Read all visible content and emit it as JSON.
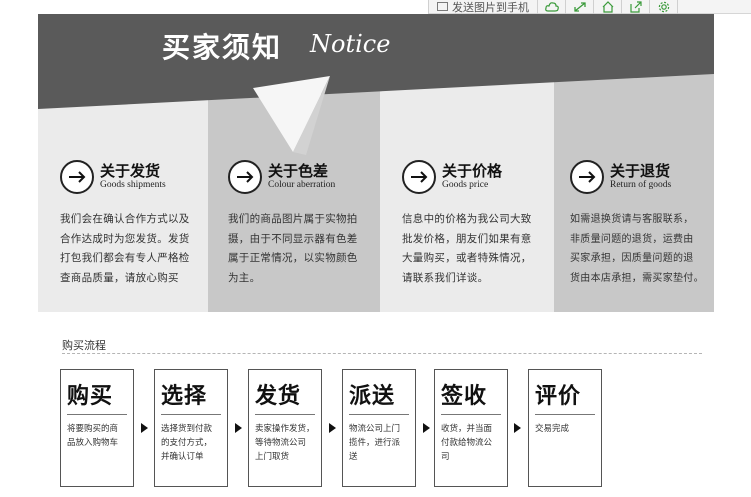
{
  "toolbar": {
    "send_label": "发送图片到手机"
  },
  "banner": {
    "title_zh": "买家须知",
    "title_en": "Notice"
  },
  "sections": [
    {
      "title": "关于发货",
      "subtitle": "Goods shipments",
      "lines": [
        "我们会在确认合作方式以及",
        "合作达成时为您发货。发货",
        "打包我们都会有专人严格检",
        "查商品质量，请放心购买"
      ]
    },
    {
      "title": "关于色差",
      "subtitle": "Colour aberration",
      "lines": [
        "我们的商品图片属于实物拍",
        "摄，由于不同显示器有色差",
        "属于正常情况，以实物颜色",
        "为主。"
      ]
    },
    {
      "title": "关于价格",
      "subtitle": "Goods price",
      "lines": [
        "信息中的价格为我公司大致",
        "批发价格，朋友们如果有意",
        "大量购买，或者特殊情况，",
        "请联系我们详谈。"
      ]
    },
    {
      "title": "关于退货",
      "subtitle": "Return of goods",
      "lines": [
        "如需退换货请与客服联系，",
        "非质量问题的退货，运费由",
        "买家承担，因质量问题的退",
        "货由本店承担，需买家垫付。"
      ]
    }
  ],
  "process": {
    "title": "购买流程",
    "steps": [
      {
        "title": "购买",
        "lines": [
          "将要购买的商",
          "品放入购物车"
        ]
      },
      {
        "title": "选择",
        "lines": [
          "选择货到付款",
          "的支付方式，",
          "并确认订单"
        ]
      },
      {
        "title": "发货",
        "lines": [
          "卖家操作发货，",
          "等待物流公司",
          "上门取货"
        ]
      },
      {
        "title": "派送",
        "lines": [
          "物流公司上门",
          "揽件，进行派",
          "送"
        ]
      },
      {
        "title": "签收",
        "lines": [
          "收货，并当面",
          "付款给物流公",
          "司"
        ]
      },
      {
        "title": "评价",
        "lines": [
          "交易完成"
        ]
      }
    ]
  },
  "colors": {
    "banner_dark": "#5a5a5a",
    "panel_light": "#ebebeb",
    "panel_mid": "#c8c8c8"
  }
}
